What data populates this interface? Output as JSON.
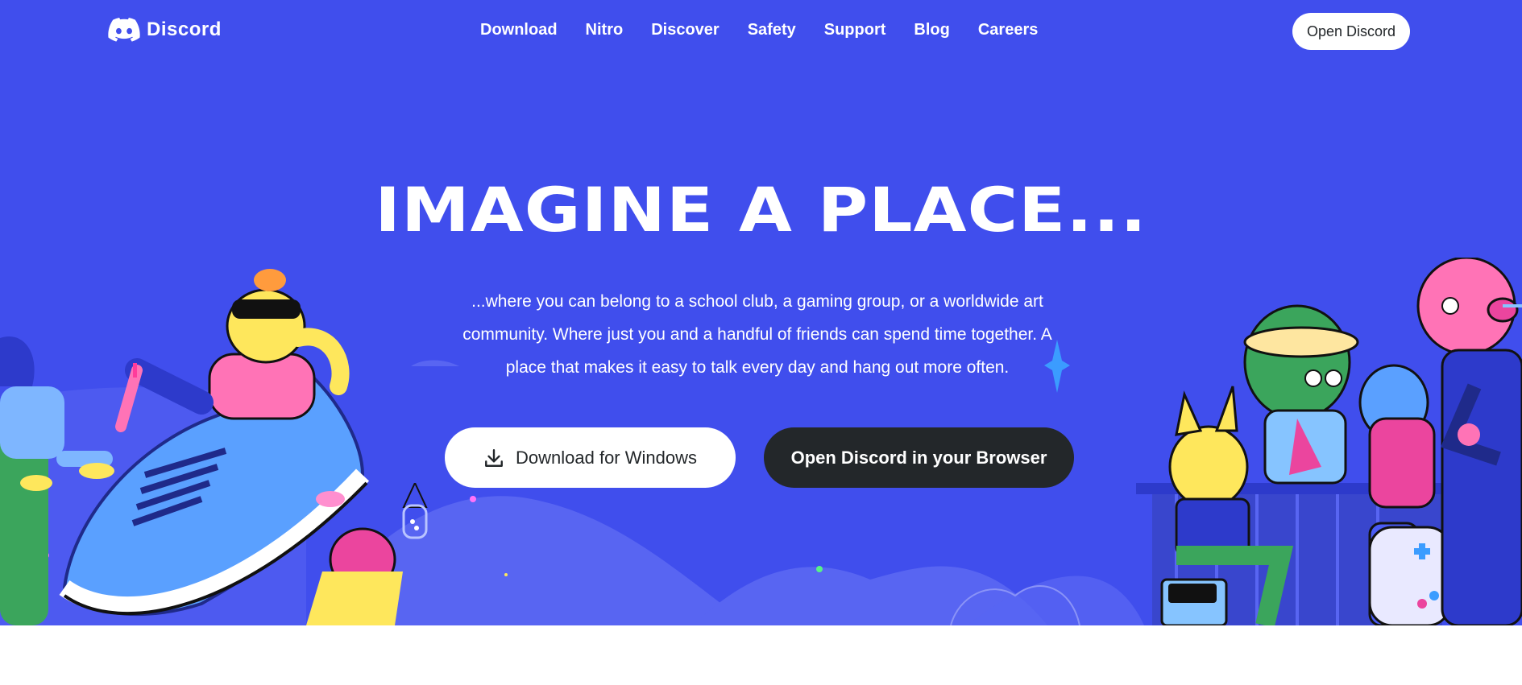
{
  "brand": {
    "name": "Discord",
    "icon": "discord-logo-icon"
  },
  "nav": {
    "links": [
      "Download",
      "Nitro",
      "Discover",
      "Safety",
      "Support",
      "Blog",
      "Careers"
    ],
    "open_button": "Open Discord"
  },
  "hero": {
    "headline": "IMAGINE A PLACE...",
    "subtext": "...where you can belong to a school club, a gaming group, or a worldwide art community. Where just you and a handful of friends can spend time together. A place that makes it easy to talk every day and hang out more often.",
    "download_button": "Download for Windows",
    "download_icon": "download-icon",
    "browser_button": "Open Discord in your Browser"
  },
  "colors": {
    "blurple": "#404eed",
    "dark": "#23272a",
    "white": "#ffffff"
  }
}
